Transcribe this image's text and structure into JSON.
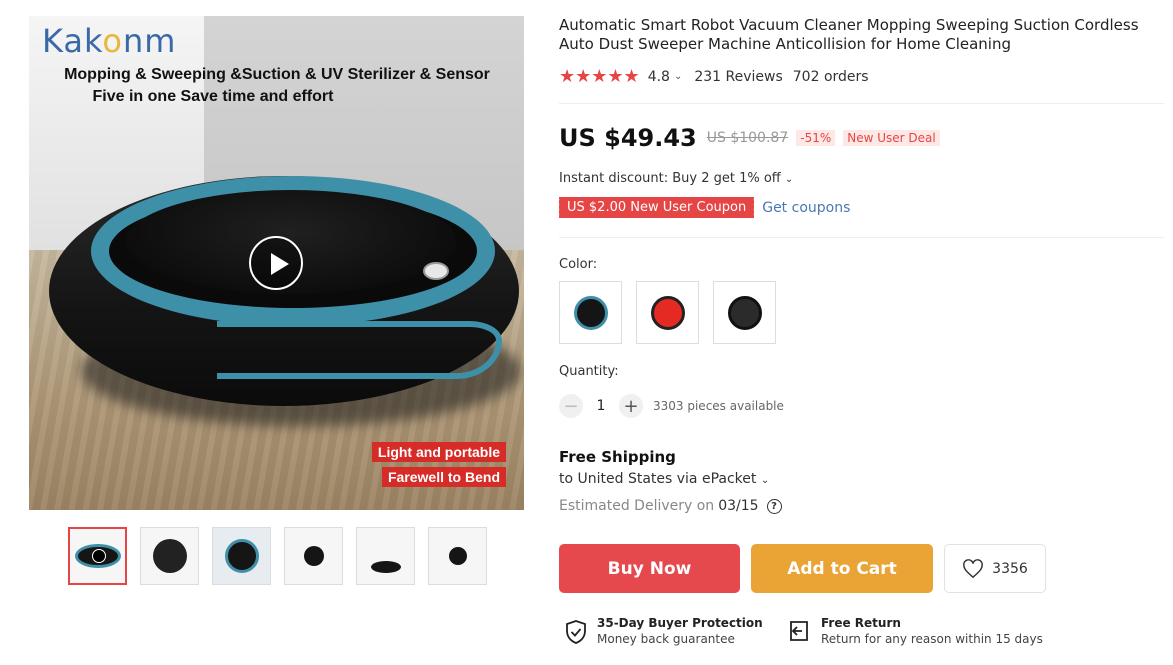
{
  "gallery": {
    "brand": "KAKONM",
    "banner_line1": "Mopping & Sweeping &Suction & UV Sterilizer & Sensor",
    "banner_line2": "Five in one Save time and effort",
    "tag_line1": "Light and portable",
    "tag_line2": "Farewell to Bend",
    "thumbnail_count": 6
  },
  "product": {
    "title": "Automatic Smart Robot Vacuum Cleaner Mopping Sweeping Suction Cordless Auto Dust Sweeper Machine Anticollision for Home Cleaning",
    "stars": "★★★★★",
    "rating": "4.8",
    "reviews": "231 Reviews",
    "orders": "702 orders"
  },
  "price": {
    "current": "US $49.43",
    "original": "US $100.87",
    "discount": "-51%",
    "deal": "New User Deal",
    "instant_discount": "Instant discount: Buy 2 get 1% off",
    "coupon": "US $2.00 New User Coupon",
    "get_coupons": "Get coupons"
  },
  "options": {
    "color_label": "Color:",
    "colors": [
      "#151515",
      "#e42a22",
      "#2b2b2b"
    ],
    "quantity_label": "Quantity:",
    "quantity": "1",
    "available": "3303 pieces available"
  },
  "shipping": {
    "title": "Free Shipping",
    "destination": "to United States via ePacket",
    "delivery_prefix": "Estimated Delivery on",
    "delivery_date": "03/15"
  },
  "actions": {
    "buy_now": "Buy Now",
    "add_to_cart": "Add to Cart",
    "wishlist_count": "3356"
  },
  "guarantees": {
    "protection_title": "35-Day Buyer Protection",
    "protection_sub": "Money back guarantee",
    "return_title": "Free Return",
    "return_sub": "Return for any reason within 15 days"
  },
  "colors": {
    "accent": "#e64545",
    "buy_now": "#e5484d",
    "add_to_cart": "#eaa436",
    "link": "#4a78b5",
    "robot_teal": "#3e8fa8"
  }
}
